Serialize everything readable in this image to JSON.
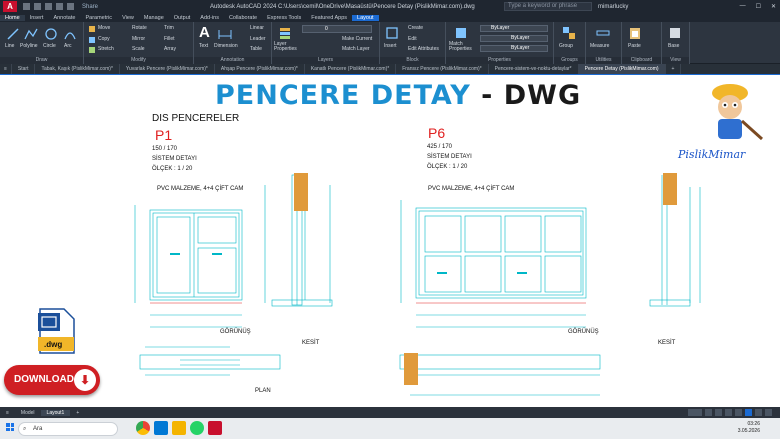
{
  "app": {
    "title": "Autodesk AutoCAD 2024    C:\\Users\\cemil\\OneDrive\\Masaüstü\\Pencere Detay (PislikMimar.com).dwg",
    "share": "Share",
    "search_placeholder": "Type a keyword or phrase",
    "user": "mimarlucky"
  },
  "menu_tabs": [
    "Home",
    "Insert",
    "Annotate",
    "Parametric",
    "View",
    "Manage",
    "Output",
    "Add-ins",
    "Collaborate",
    "Express Tools",
    "Featured Apps",
    "Layout"
  ],
  "ribbon": {
    "draw": {
      "title": "Draw",
      "line": "Line",
      "polyline": "Polyline",
      "circle": "Circle",
      "arc": "Arc"
    },
    "modify": {
      "title": "Modify",
      "move": "Move",
      "rotate": "Rotate",
      "trim": "Trim",
      "copy": "Copy",
      "mirror": "Mirror",
      "fillet": "Fillet",
      "stretch": "Stretch",
      "scale": "Scale",
      "array": "Array"
    },
    "annotation": {
      "title": "Annotation",
      "text": "Text",
      "dimension": "Dimension",
      "linear": "Linear",
      "leader": "Leader",
      "table": "Table"
    },
    "layers": {
      "title": "Layers",
      "layer_props": "Layer Properties",
      "layer_value": "0",
      "make_current": "Make Current",
      "match_layer": "Match Layer"
    },
    "block": {
      "title": "Block",
      "insert": "Insert",
      "create": "Create",
      "edit": "Edit",
      "edit_attr": "Edit Attributes"
    },
    "properties": {
      "title": "Properties",
      "match": "Match Properties",
      "bylayer1": "ByLayer",
      "bylayer2": "ByLayer",
      "bylayer3": "ByLayer"
    },
    "groups": {
      "title": "Groups",
      "group": "Group"
    },
    "utilities": {
      "title": "Utilities",
      "measure": "Measure"
    },
    "clipboard": {
      "title": "Clipboard",
      "paste": "Paste"
    },
    "view": {
      "title": "View",
      "base": "Base"
    }
  },
  "doc_tabs": [
    "Start",
    "Tabak, Kaşık (PislikMimar.com)*",
    "Yuvarlak Pencere (PislikMimar.com)*",
    "Ahşap Pencere (PislikMimar.com)*",
    "Kanatlı Pencere (PislikMimar.com)*",
    "Fransız Pencere (PislikMimar.com)*",
    "Pencere-sistem-ve-noktu-detaylar*",
    "Pencere Detay (PislikMimar.com)"
  ],
  "drawing": {
    "title_blue": "PENCERE DETAY",
    "title_dark": " - DWG",
    "heading": "DIS PENCERELER",
    "p1": {
      "label": "P1",
      "size": "150 / 170",
      "system": "SİSTEM DETAYI",
      "scale": "ÖLÇEK : 1 / 20",
      "material": "PVC MALZEME, 4+4 ÇİFT CAM",
      "gorunus": "GÖRÜNÜŞ",
      "kesit": "KESİT",
      "plan": "PLAN"
    },
    "p6": {
      "label": "P6",
      "size": "425 / 170",
      "system": "SİSTEM DETAYI",
      "scale": "ÖLÇEK : 1 / 20",
      "material": "PVC MALZEME, 4+4 ÇİFT CAM",
      "gorunus": "GÖRÜNÜŞ",
      "kesit": "KESİT"
    },
    "brand": "PislikMimar",
    "dwg_label": ".dwg",
    "download": "DOWNLOAD"
  },
  "layout_tabs": [
    "Model",
    "Layout1"
  ],
  "taskbar": {
    "search": "Ara",
    "time": "03:26",
    "date": "3.05.2026"
  },
  "colors": {
    "cad_cyan": "#00b7c7",
    "cad_red": "#e02020",
    "title_blue": "#1c8fd0",
    "download_red": "#cf1f23"
  }
}
